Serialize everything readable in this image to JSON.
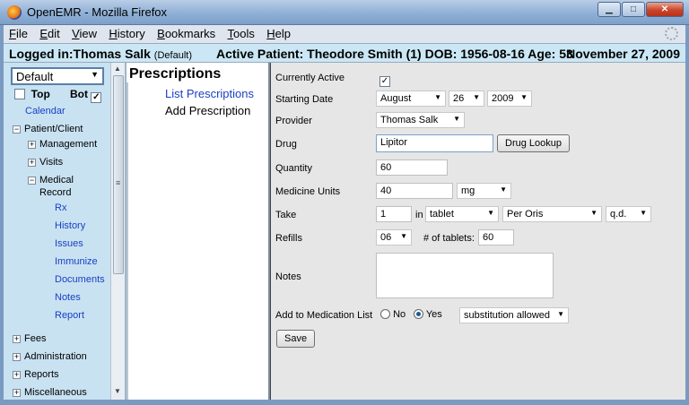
{
  "window": {
    "title": "OpenEMR - Mozilla Firefox",
    "min": "▁",
    "max": "□",
    "close": "✕"
  },
  "menu": [
    {
      "label": "File"
    },
    {
      "label": "Edit"
    },
    {
      "label": "View"
    },
    {
      "label": "History"
    },
    {
      "label": "Bookmarks"
    },
    {
      "label": "Tools"
    },
    {
      "label": "Help"
    }
  ],
  "status": {
    "login": "Logged in:Thomas Salk",
    "login_note": "(Default)",
    "active_patient": "Active Patient: Theodore Smith (1) DOB: 1956-08-16 Age: 53",
    "date": "November 27, 2009"
  },
  "leftnav": {
    "profile": "Default",
    "top_label": "Top",
    "bot_label": "Bot",
    "items": {
      "calendar": "Calendar",
      "patient_client": "Patient/Client",
      "management": "Management",
      "visits": "Visits",
      "medical_record_1": "Medical",
      "medical_record_2": "Record",
      "rx": "Rx",
      "history": "History",
      "issues": "Issues",
      "immunize": "Immunize",
      "documents": "Documents",
      "notes": "Notes",
      "report": "Report",
      "fees": "Fees",
      "administration": "Administration",
      "reports": "Reports",
      "misc": "Miscellaneous"
    }
  },
  "mid": {
    "heading": "Prescriptions",
    "list_link": "List Prescriptions",
    "add_link": "Add Prescription"
  },
  "form": {
    "labels": {
      "currently_active": "Currently Active",
      "starting_date": "Starting Date",
      "provider": "Provider",
      "drug": "Drug",
      "quantity": "Quantity",
      "medicine_units": "Medicine Units",
      "take": "Take",
      "refills": "Refills",
      "notes": "Notes",
      "add_to_med_list": "Add to Medication List"
    },
    "currently_active_checked": true,
    "start_month": "August",
    "start_day": "26",
    "start_year": "2009",
    "provider": "Thomas Salk",
    "drug": "Lipitor",
    "drug_lookup_btn": "Drug Lookup",
    "quantity": "60",
    "units_value": "40",
    "units_unit": "mg",
    "take_amount": "1",
    "in_label": "in",
    "take_form": "tablet",
    "take_route": "Per Oris",
    "take_interval": "q.d.",
    "refills": "06",
    "tablets_label": "# of tablets:",
    "tablets_value": "60",
    "notes": "",
    "no_label": "No",
    "yes_label": "Yes",
    "med_list_selected": "Yes",
    "substitution": "substitution allowed",
    "save_btn": "Save"
  }
}
